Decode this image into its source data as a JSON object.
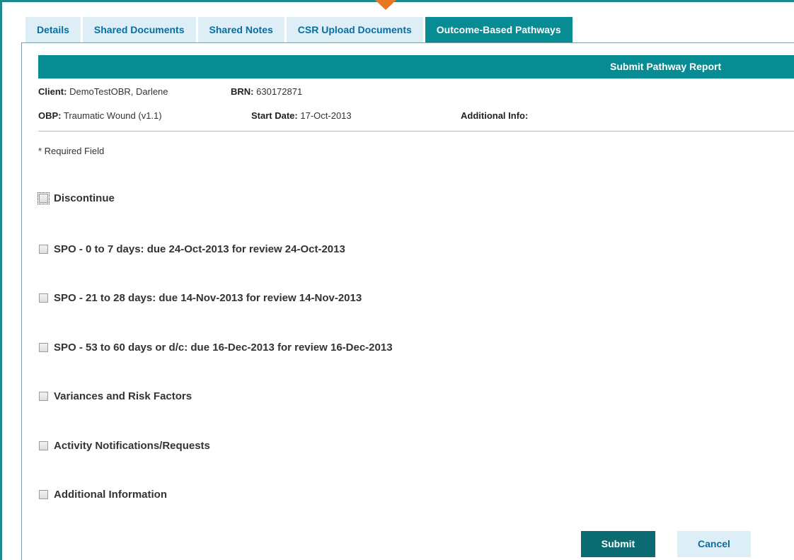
{
  "tabs": [
    {
      "label": "Details"
    },
    {
      "label": "Shared Documents"
    },
    {
      "label": "Shared Notes"
    },
    {
      "label": "CSR Upload Documents"
    },
    {
      "label": "Outcome-Based Pathways"
    }
  ],
  "active_tab_index": 4,
  "header": {
    "title": "Submit Pathway Report"
  },
  "client_info": {
    "client_label": "Client:",
    "client_value": "DemoTestOBR, Darlene",
    "brn_label": "BRN:",
    "brn_value": "630172871",
    "obp_label": "OBP:",
    "obp_value": "Traumatic Wound (v1.1)",
    "start_date_label": "Start Date:",
    "start_date_value": "17-Oct-2013",
    "additional_info_label": "Additional Info:"
  },
  "required_note": "* Required Field",
  "checkboxes": [
    {
      "label": "Discontinue",
      "checked": false
    },
    {
      "label": "SPO - 0 to 7 days: due 24-Oct-2013 for review 24-Oct-2013",
      "checked": false
    },
    {
      "label": "SPO - 21 to 28 days: due 14-Nov-2013 for review 14-Nov-2013",
      "checked": false
    },
    {
      "label": "SPO - 53 to 60 days or d/c: due 16-Dec-2013 for review 16-Dec-2013",
      "checked": false
    },
    {
      "label": "Variances and Risk Factors",
      "checked": false
    },
    {
      "label": "Activity Notifications/Requests",
      "checked": false
    },
    {
      "label": "Additional Information",
      "checked": false
    }
  ],
  "buttons": {
    "submit_label": "Submit",
    "cancel_label": "Cancel"
  },
  "colors": {
    "accent": "#078c94",
    "tab_bg": "#ddeef7",
    "tab_text": "#0a6d9e",
    "submit_bg": "#0b6b73",
    "drag_indicator": "#e87722"
  }
}
